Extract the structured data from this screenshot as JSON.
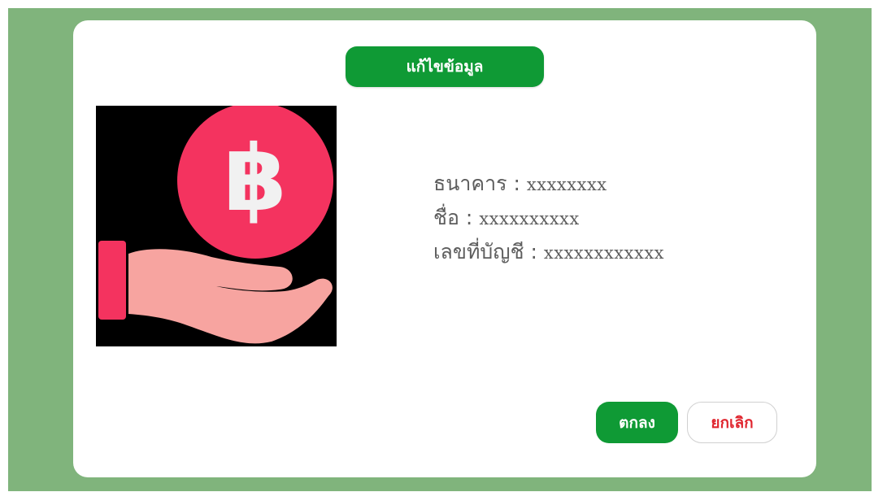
{
  "dialog": {
    "edit_label": "แก้ไขข้อมูล",
    "illustration": {
      "icon": "hand-holding-baht-coin-icon",
      "coin_symbol": "฿",
      "colors": {
        "background": "#000000",
        "coin": "#f4335f",
        "hand": "#f7a4a0",
        "cuff": "#f4335f"
      }
    },
    "info": {
      "separator": " : ",
      "rows": [
        {
          "label": "ธนาคาร",
          "value": "xxxxxxxx"
        },
        {
          "label": "ชื่อ",
          "value": "xxxxxxxxxx"
        },
        {
          "label": "เลขที่บัญชี",
          "value": "xxxxxxxxxxxx"
        }
      ]
    },
    "ok_label": "ตกลง",
    "cancel_label": "ยกเลิก"
  },
  "colors": {
    "backdrop": "#80b47c",
    "accent": "#0f9a35",
    "cancel_text": "#e0262f",
    "info_text": "#5e5e5e"
  }
}
